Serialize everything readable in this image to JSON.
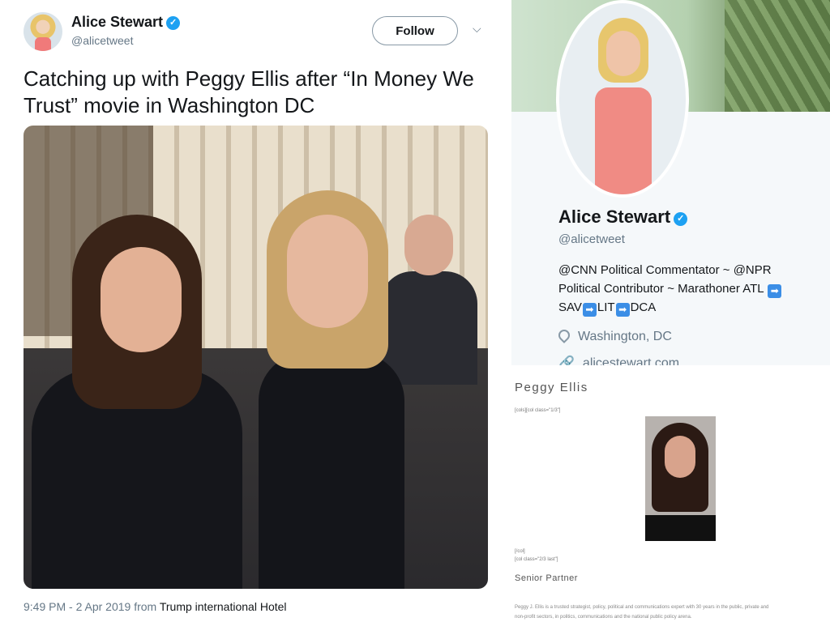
{
  "tweet": {
    "author_name": "Alice Stewart",
    "handle": "@alicetweet",
    "follow_label": "Follow",
    "caret_icon": "chevron-down-icon",
    "verified_icon": "verified-badge-icon",
    "text": "Catching up with Peggy Ellis after “In Money We Trust” movie in Washington DC",
    "timestamp": "9:49 PM - 2 Apr 2019 from",
    "source": "Trump international Hotel"
  },
  "profile": {
    "name": "Alice Stewart",
    "handle": "@alicetweet",
    "bio_line1": "@CNN Political Commentator ~ @NPR",
    "bio_line2": "Political Contributor ~ Marathoner ATL",
    "bio_line3_a": "SAV",
    "bio_line3_b": "LIT",
    "bio_line3_c": "DCA",
    "arrow_glyph": "➡",
    "location": "Washington, DC",
    "website": "alicestewart.com"
  },
  "bio_page": {
    "name": "Peggy Ellis",
    "shortcode_1": "[cols][col class=\"1/3\"]",
    "shortcode_2": "[/col]",
    "shortcode_3": "[col class=\"2/3 last\"]",
    "title": "Senior Partner",
    "desc_line1": "Peggy J. Ellis is a trusted strategist, policy, political and communications expert with 30 years in the public, private and",
    "desc_line2": "non-profit sectors, in politics, communications and the national public policy arena."
  },
  "colors": {
    "twitter_blue": "#1da1f2",
    "text_primary": "#14171a",
    "text_secondary": "#657786"
  }
}
